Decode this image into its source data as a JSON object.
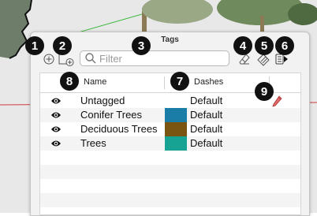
{
  "panel": {
    "title": "Tags"
  },
  "search": {
    "placeholder": "Filter",
    "value": ""
  },
  "columns": {
    "name": "Name",
    "dashes": "Dashes"
  },
  "tags": [
    {
      "name": "Untagged",
      "color": "",
      "dashes": "Default",
      "visible": true
    },
    {
      "name": "Conifer Trees",
      "color": "#1a7da8",
      "dashes": "Default",
      "visible": true
    },
    {
      "name": "Deciduous Trees",
      "color": "#7a5512",
      "dashes": "Default",
      "visible": true
    },
    {
      "name": "Trees",
      "color": "#16a393",
      "dashes": "Default",
      "visible": true
    }
  ],
  "callouts": [
    "1",
    "2",
    "3",
    "4",
    "5",
    "6",
    "7",
    "8",
    "9"
  ],
  "icons": {
    "add_tag": "add-tag-icon",
    "add_folder": "add-folder-icon",
    "search": "search-icon",
    "eraser": "eraser-icon",
    "color_by_tag": "color-by-tag-icon",
    "details": "details-arrow-icon",
    "visibility": "eye-icon",
    "active_tag": "pencil-icon"
  }
}
